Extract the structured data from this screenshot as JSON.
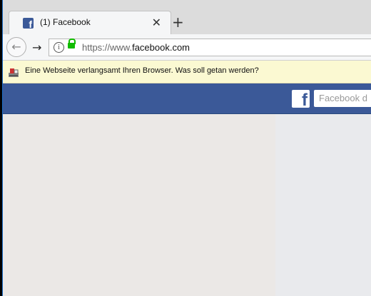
{
  "browser": {
    "tab": {
      "title": "(1) Facebook",
      "favicon": "facebook-icon"
    },
    "new_tab_symbol": "+",
    "close_symbol": "✕",
    "nav": {
      "back": "←",
      "forward": "→"
    },
    "url": {
      "scheme": "https://www.",
      "domain": "facebook.com",
      "info_symbol": "i"
    }
  },
  "notification": {
    "text": "Eine Webseite verlangsamt Ihren Browser. Was soll getan werden?"
  },
  "facebook": {
    "logo_letter": "f",
    "search_placeholder": "Facebook d",
    "brand_color": "#3b5998"
  },
  "colors": {
    "accent": "#12bc00",
    "notify_bg": "#fbf9d2"
  }
}
